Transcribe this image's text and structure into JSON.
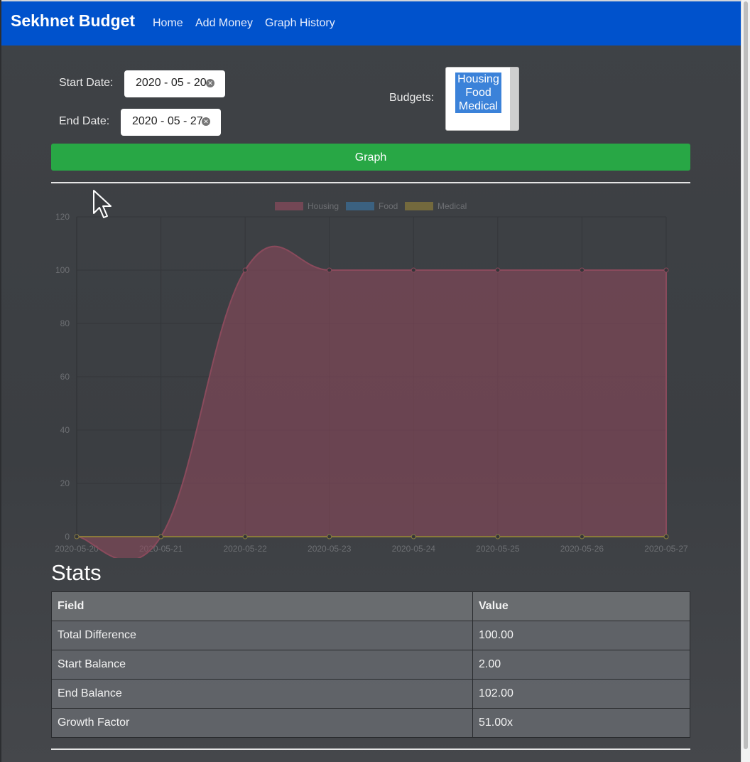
{
  "navbar": {
    "brand": "Sekhnet Budget",
    "links": [
      "Home",
      "Add Money",
      "Graph History"
    ]
  },
  "form": {
    "start_label": "Start Date:",
    "start_value": "2020 - 05 - 20",
    "end_label": "End Date:",
    "end_value": "2020 - 05 - 27",
    "budgets_label": "Budgets:",
    "budget_options": [
      "Housing",
      "Food",
      "Medical"
    ],
    "graph_button": "Graph"
  },
  "chart_data": {
    "type": "area",
    "x": [
      "2020-05-20",
      "2020-05-21",
      "2020-05-22",
      "2020-05-23",
      "2020-05-24",
      "2020-05-25",
      "2020-05-26",
      "2020-05-27"
    ],
    "series": [
      {
        "name": "Housing",
        "values": [
          0,
          0,
          100,
          100,
          100,
          100,
          100,
          100
        ],
        "color": "#8a4a5c"
      },
      {
        "name": "Food",
        "values": [
          0,
          0,
          0,
          0,
          0,
          0,
          0,
          0
        ],
        "color": "#3a6f9a"
      },
      {
        "name": "Medical",
        "values": [
          0,
          0,
          0,
          0,
          0,
          0,
          0,
          0
        ],
        "color": "#8a7a3a"
      }
    ],
    "yticks": [
      0,
      20,
      40,
      60,
      80,
      100,
      120
    ],
    "ylim": [
      0,
      120
    ],
    "grid": true,
    "legend": "top"
  },
  "stats": {
    "title": "Stats",
    "headers": [
      "Field",
      "Value"
    ],
    "rows": [
      [
        "Total Difference",
        "100.00"
      ],
      [
        "Start Balance",
        "2.00"
      ],
      [
        "End Balance",
        "102.00"
      ],
      [
        "Growth Factor",
        "51.00x"
      ]
    ]
  }
}
